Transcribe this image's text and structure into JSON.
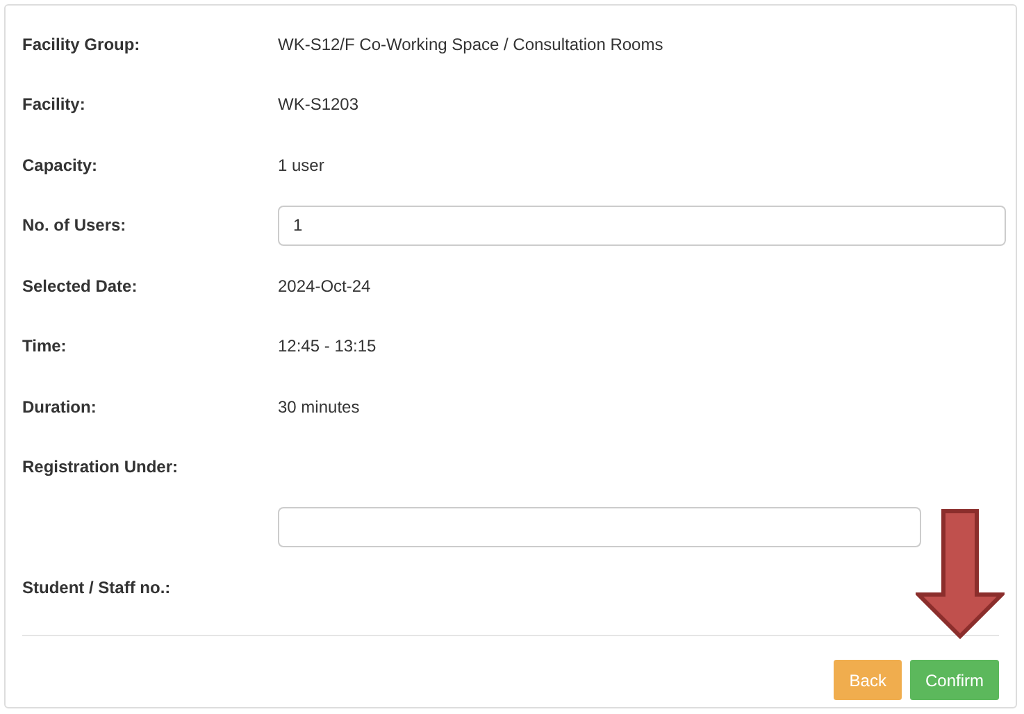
{
  "fields": [
    {
      "kind": "text",
      "label": "Facility Group:",
      "value": "WK-S12/F Co-Working Space / Consultation Rooms"
    },
    {
      "kind": "text",
      "label": "Facility:",
      "value": "WK-S1203"
    },
    {
      "kind": "text",
      "label": "Capacity:",
      "value": "1 user"
    },
    {
      "kind": "input",
      "label": "No. of Users:",
      "value": "1"
    },
    {
      "kind": "text",
      "label": "Selected Date:",
      "value": "2024-Oct-24"
    },
    {
      "kind": "text",
      "label": "Time:",
      "value": "12:45 - 13:15"
    },
    {
      "kind": "text",
      "label": "Duration:",
      "value": "30 minutes"
    },
    {
      "kind": "label",
      "label": "Registration Under:"
    },
    {
      "kind": "short-input"
    },
    {
      "kind": "label",
      "label": "Student / Staff no.:"
    }
  ],
  "buttons": [
    {
      "kind": "back",
      "label": "Back"
    },
    {
      "kind": "confirm",
      "label": "Confirm"
    }
  ]
}
